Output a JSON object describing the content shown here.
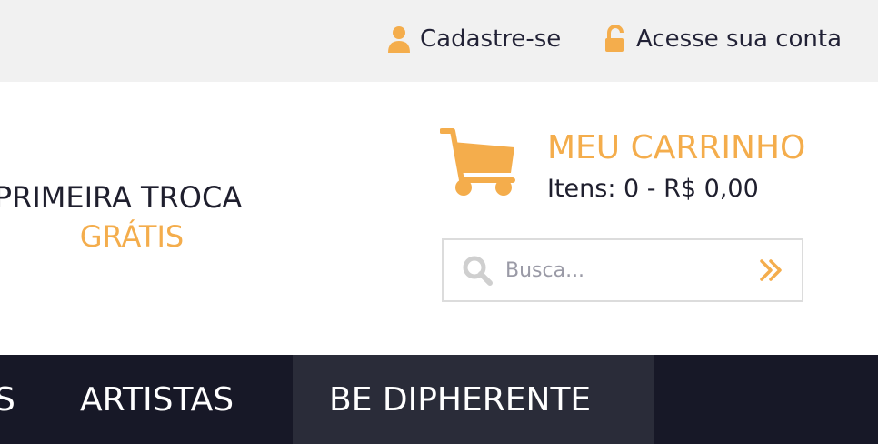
{
  "topbar": {
    "register": {
      "label": "Cadastre-se",
      "icon": "user-icon"
    },
    "login": {
      "label": "Acesse sua conta",
      "icon": "unlock-icon"
    }
  },
  "promo": {
    "line1": "PRIMEIRA TROCA",
    "line2": "GRÁTIS"
  },
  "cart": {
    "title": "MEU CARRINHO",
    "items": "Itens: 0 - R$ 0,00",
    "icon": "cart-icon"
  },
  "search": {
    "placeholder": "Busca...",
    "icon": "search-icon",
    "submit_icon": "double-chevron-right-icon"
  },
  "nav": {
    "items": [
      {
        "label": "S"
      },
      {
        "label": "ARTISTAS"
      },
      {
        "label": "BE DIPHERENTE",
        "active": true
      }
    ]
  },
  "colors": {
    "accent": "#f4ad4c",
    "nav_bg": "#171827",
    "nav_active_bg": "#2a2c39",
    "topbar_bg": "#f1f1f1"
  }
}
